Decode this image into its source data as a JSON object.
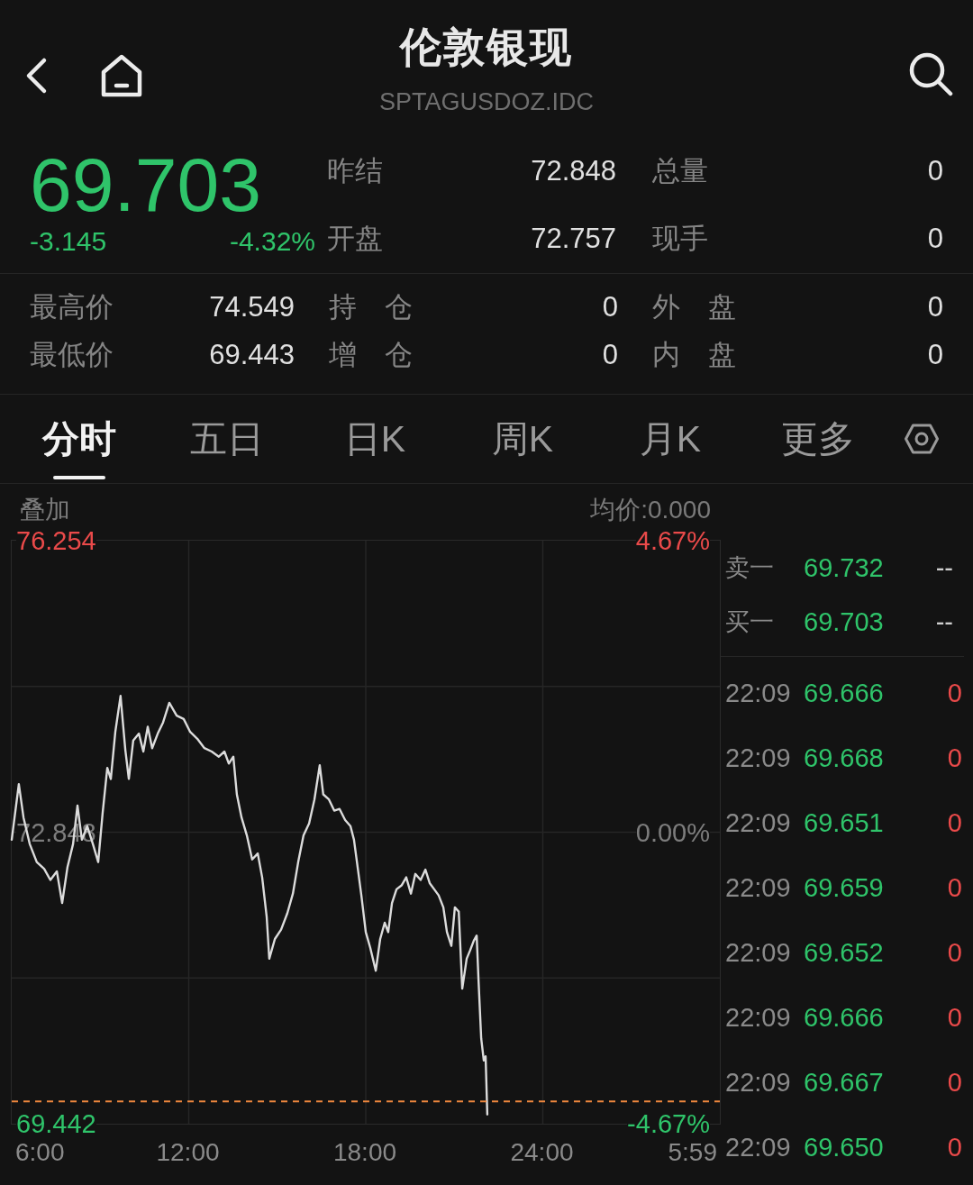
{
  "header": {
    "title": "伦敦银现",
    "subtitle": "SPTAGUSDOZ.IDC"
  },
  "quote": {
    "price": "69.703",
    "change": "-3.145",
    "change_pct": "-4.32%",
    "rows": [
      [
        {
          "label": "昨结",
          "value": "72.848"
        },
        {
          "label": "总量",
          "value": "0"
        }
      ],
      [
        {
          "label": "开盘",
          "value": "72.757"
        },
        {
          "label": "现手",
          "value": "0"
        }
      ]
    ]
  },
  "stats": {
    "rows": [
      [
        {
          "label": "最高价",
          "value": "74.549"
        },
        {
          "label": "持 仓",
          "value": "0"
        },
        {
          "label": "外 盘",
          "value": "0"
        }
      ],
      [
        {
          "label": "最低价",
          "value": "69.443"
        },
        {
          "label": "增 仓",
          "value": "0"
        },
        {
          "label": "内 盘",
          "value": "0"
        }
      ]
    ]
  },
  "tabs": [
    {
      "label": "分时",
      "selected": true
    },
    {
      "label": "五日",
      "selected": false
    },
    {
      "label": "日K",
      "selected": false
    },
    {
      "label": "周K",
      "selected": false
    },
    {
      "label": "月K",
      "selected": false
    },
    {
      "label": "更多",
      "selected": false
    }
  ],
  "chart": {
    "overlay": "叠加",
    "average": "均价:0.000",
    "percent_labels": [
      "4.67%",
      "0.00%",
      "-4.67%"
    ],
    "session_end_label": "5:59",
    "chart_data": {
      "type": "line",
      "x": [
        6,
        6.24,
        6.4,
        6.61,
        6.85,
        7.1,
        7.31,
        7.53,
        7.71,
        7.89,
        8.08,
        8.23,
        8.38,
        8.56,
        8.75,
        8.93,
        9.08,
        9.24,
        9.36,
        9.51,
        9.69,
        9.85,
        9.97,
        10.12,
        10.31,
        10.46,
        10.61,
        10.76,
        10.95,
        11.13,
        11.34,
        11.59,
        11.83,
        12.05,
        12.29,
        12.53,
        12.78,
        13.02,
        13.21,
        13.36,
        13.51,
        13.63,
        13.79,
        13.97,
        14.15,
        14.34,
        14.49,
        14.64,
        14.73,
        14.92,
        15.13,
        15.34,
        15.53,
        15.71,
        15.89,
        16.08,
        16.26,
        16.44,
        16.56,
        16.75,
        16.93,
        17.11,
        17.3,
        17.48,
        17.6,
        17.73,
        17.85,
        18.0,
        18.15,
        18.34,
        18.49,
        18.64,
        18.76,
        18.89,
        19.04,
        19.22,
        19.37,
        19.53,
        19.68,
        19.86,
        20.02,
        20.17,
        20.32,
        20.47,
        20.63,
        20.75,
        20.9,
        21.02,
        21.15,
        21.27,
        21.42,
        21.54,
        21.66,
        21.76,
        21.82,
        21.91,
        22.0,
        22.06,
        22.12
      ],
      "series": [
        {
          "color": "#dcdcdc",
          "values": [
            72.76,
            73.41,
            73.02,
            72.71,
            72.5,
            72.42,
            72.29,
            72.39,
            72.02,
            72.44,
            72.71,
            73.16,
            72.76,
            72.92,
            72.71,
            72.5,
            73.07,
            73.6,
            73.47,
            74.02,
            74.44,
            73.81,
            73.47,
            73.92,
            74,
            73.79,
            74.08,
            73.83,
            74,
            74.13,
            74.36,
            74.21,
            74.17,
            74.02,
            73.94,
            73.83,
            73.79,
            73.73,
            73.79,
            73.65,
            73.73,
            73.29,
            73.02,
            72.81,
            72.53,
            72.6,
            72.32,
            71.86,
            71.37,
            71.6,
            71.71,
            71.9,
            72.13,
            72.5,
            72.81,
            72.95,
            73.23,
            73.63,
            73.29,
            73.23,
            73.1,
            73.12,
            72.99,
            72.92,
            72.76,
            72.42,
            72.11,
            71.68,
            71.5,
            71.23,
            71.6,
            71.79,
            71.68,
            72.02,
            72.18,
            72.23,
            72.32,
            72.13,
            72.36,
            72.29,
            72.41,
            72.25,
            72.18,
            72.11,
            71.97,
            71.68,
            71.52,
            71.97,
            71.92,
            71.02,
            71.37,
            71.47,
            71.58,
            71.64,
            71.13,
            70.44,
            70.18,
            70.23,
            69.55
          ]
        }
      ],
      "xlim": [
        6,
        30
      ],
      "ylim": [
        69.442,
        76.254
      ],
      "xticks": [
        {
          "value": 6,
          "label": "6:00"
        },
        {
          "value": 12,
          "label": "12:00"
        },
        {
          "value": 18,
          "label": "18:00"
        },
        {
          "value": 24,
          "label": "24:00"
        }
      ],
      "yticks": [
        {
          "value": 76.254,
          "label": "76.254"
        },
        {
          "value": 72.848,
          "label": "72.848"
        },
        {
          "value": 69.442,
          "label": "69.442"
        }
      ],
      "grid": true,
      "ref_lines": [
        {
          "axis": "y",
          "value": 69.703
        }
      ]
    }
  },
  "order_book": {
    "quotes": [
      {
        "label": "卖一",
        "price": "69.732",
        "volume": "--"
      },
      {
        "label": "买一",
        "price": "69.703",
        "volume": "--"
      }
    ],
    "trades": [
      {
        "time": "22:09",
        "price": "69.666",
        "volume": "0"
      },
      {
        "time": "22:09",
        "price": "69.668",
        "volume": "0"
      },
      {
        "time": "22:09",
        "price": "69.651",
        "volume": "0"
      },
      {
        "time": "22:09",
        "price": "69.659",
        "volume": "0"
      },
      {
        "time": "22:09",
        "price": "69.652",
        "volume": "0"
      },
      {
        "time": "22:09",
        "price": "69.666",
        "volume": "0"
      },
      {
        "time": "22:09",
        "price": "69.667",
        "volume": "0"
      },
      {
        "time": "22:09",
        "price": "69.650",
        "volume": "0"
      }
    ]
  }
}
